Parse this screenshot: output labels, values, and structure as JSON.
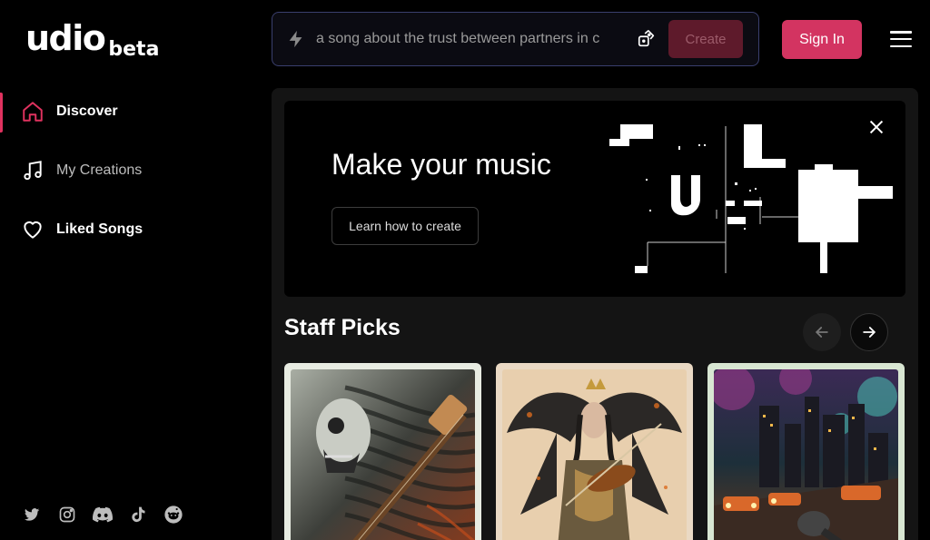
{
  "brand": {
    "name": "udio",
    "tag": "beta"
  },
  "sidebar": {
    "items": [
      {
        "label": "Discover",
        "icon": "home-icon",
        "active": true
      },
      {
        "label": "My Creations",
        "icon": "music-note-icon",
        "active": false
      },
      {
        "label": "Liked Songs",
        "icon": "heart-icon",
        "active": false
      }
    ],
    "socials": [
      "twitter-icon",
      "instagram-icon",
      "discord-icon",
      "tiktok-icon",
      "reddit-icon"
    ]
  },
  "topbar": {
    "prompt_value": "a song about the trust between partners in c",
    "create_label": "Create",
    "signin_label": "Sign In"
  },
  "hero": {
    "title": "Make your music",
    "button_label": "Learn how to create"
  },
  "staff_picks": {
    "title": "Staff Picks",
    "cards": [
      {
        "art": "biomechanical guitarist",
        "frame": "#e8ece2"
      },
      {
        "art": "winged violinist",
        "frame": "#ead9c4"
      },
      {
        "art": "neon city street with microphone",
        "frame": "#d8e6d2"
      }
    ]
  },
  "colors": {
    "accent": "#d33461",
    "background": "#000000",
    "panel": "#141414",
    "prompt_border": "#3a3f6e"
  }
}
